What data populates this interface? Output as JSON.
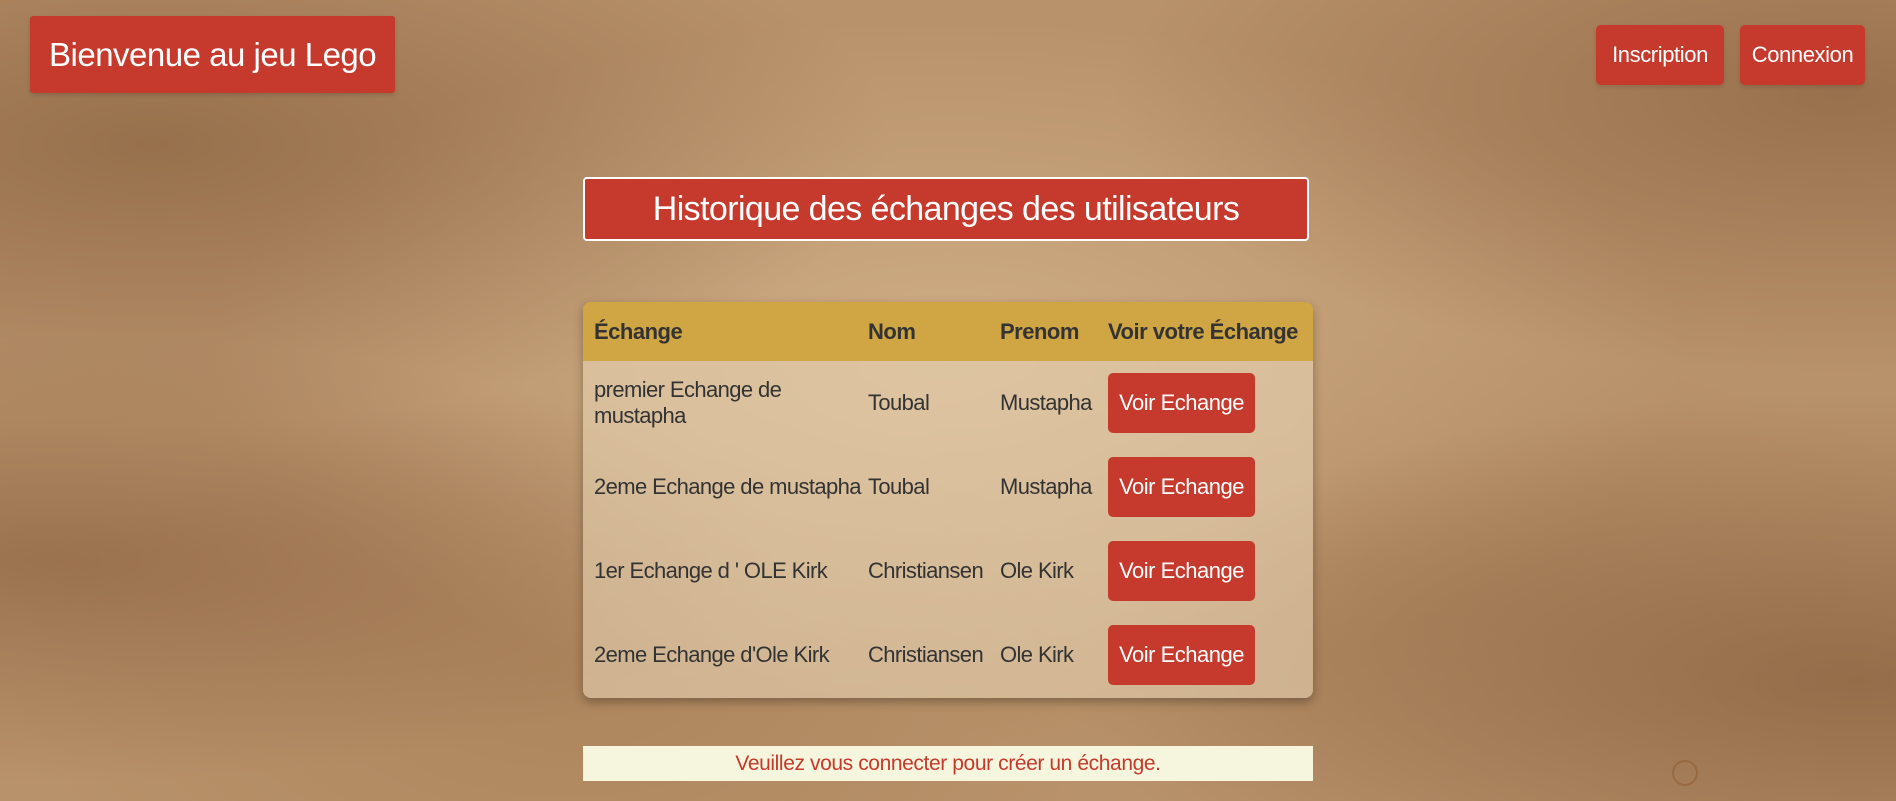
{
  "header": {
    "brand_title": "Bienvenue au jeu Lego",
    "inscription_label": "Inscription",
    "connexion_label": "Connexion"
  },
  "main": {
    "title": "Historique des échanges des utilisateurs",
    "table": {
      "columns": [
        "Échange",
        "Nom",
        "Prenom",
        "Voir votre Échange"
      ],
      "rows": [
        {
          "echange": "premier Echange de mustapha",
          "nom": "Toubal",
          "prenom": "Mustapha",
          "action": "Voir Echange"
        },
        {
          "echange": "2eme Echange de mustapha",
          "nom": "Toubal",
          "prenom": "Mustapha",
          "action": "Voir Echange"
        },
        {
          "echange": "1er Echange d ' OLE Kirk",
          "nom": "Christiansen",
          "prenom": "Ole Kirk",
          "action": "Voir Echange"
        },
        {
          "echange": "2eme Echange d'Ole Kirk",
          "nom": "Christiansen",
          "prenom": "Ole Kirk",
          "action": "Voir Echange"
        }
      ]
    },
    "notice": "Veuillez vous connecter pour créer un échange."
  },
  "colors": {
    "accent_red": "#c53a2c",
    "table_header": "#d0a544",
    "notice_background": "#f6f5dd",
    "parchment": "#b8926a"
  }
}
